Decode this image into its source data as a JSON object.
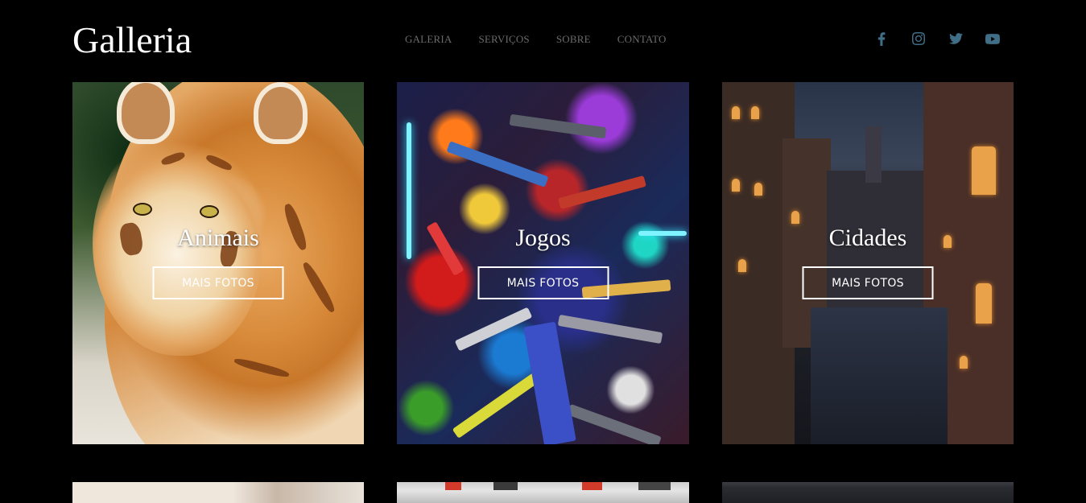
{
  "header": {
    "logo": "Galleria",
    "nav": [
      "GALERIA",
      "SERVIÇOS",
      "SOBRE",
      "CONTATO"
    ],
    "social": [
      "facebook-icon",
      "instagram-icon",
      "twitter-icon",
      "youtube-icon"
    ]
  },
  "cards": [
    {
      "title": "Animais",
      "button": "MAIS FOTOS"
    },
    {
      "title": "Jogos",
      "button": "MAIS FOTOS"
    },
    {
      "title": "Cidades",
      "button": "MAIS FOTOS"
    }
  ],
  "colors": {
    "background": "#000000",
    "nav_text": "#6b6b6b",
    "social_icons": "#3f6e86",
    "button_border": "#ffffff"
  }
}
